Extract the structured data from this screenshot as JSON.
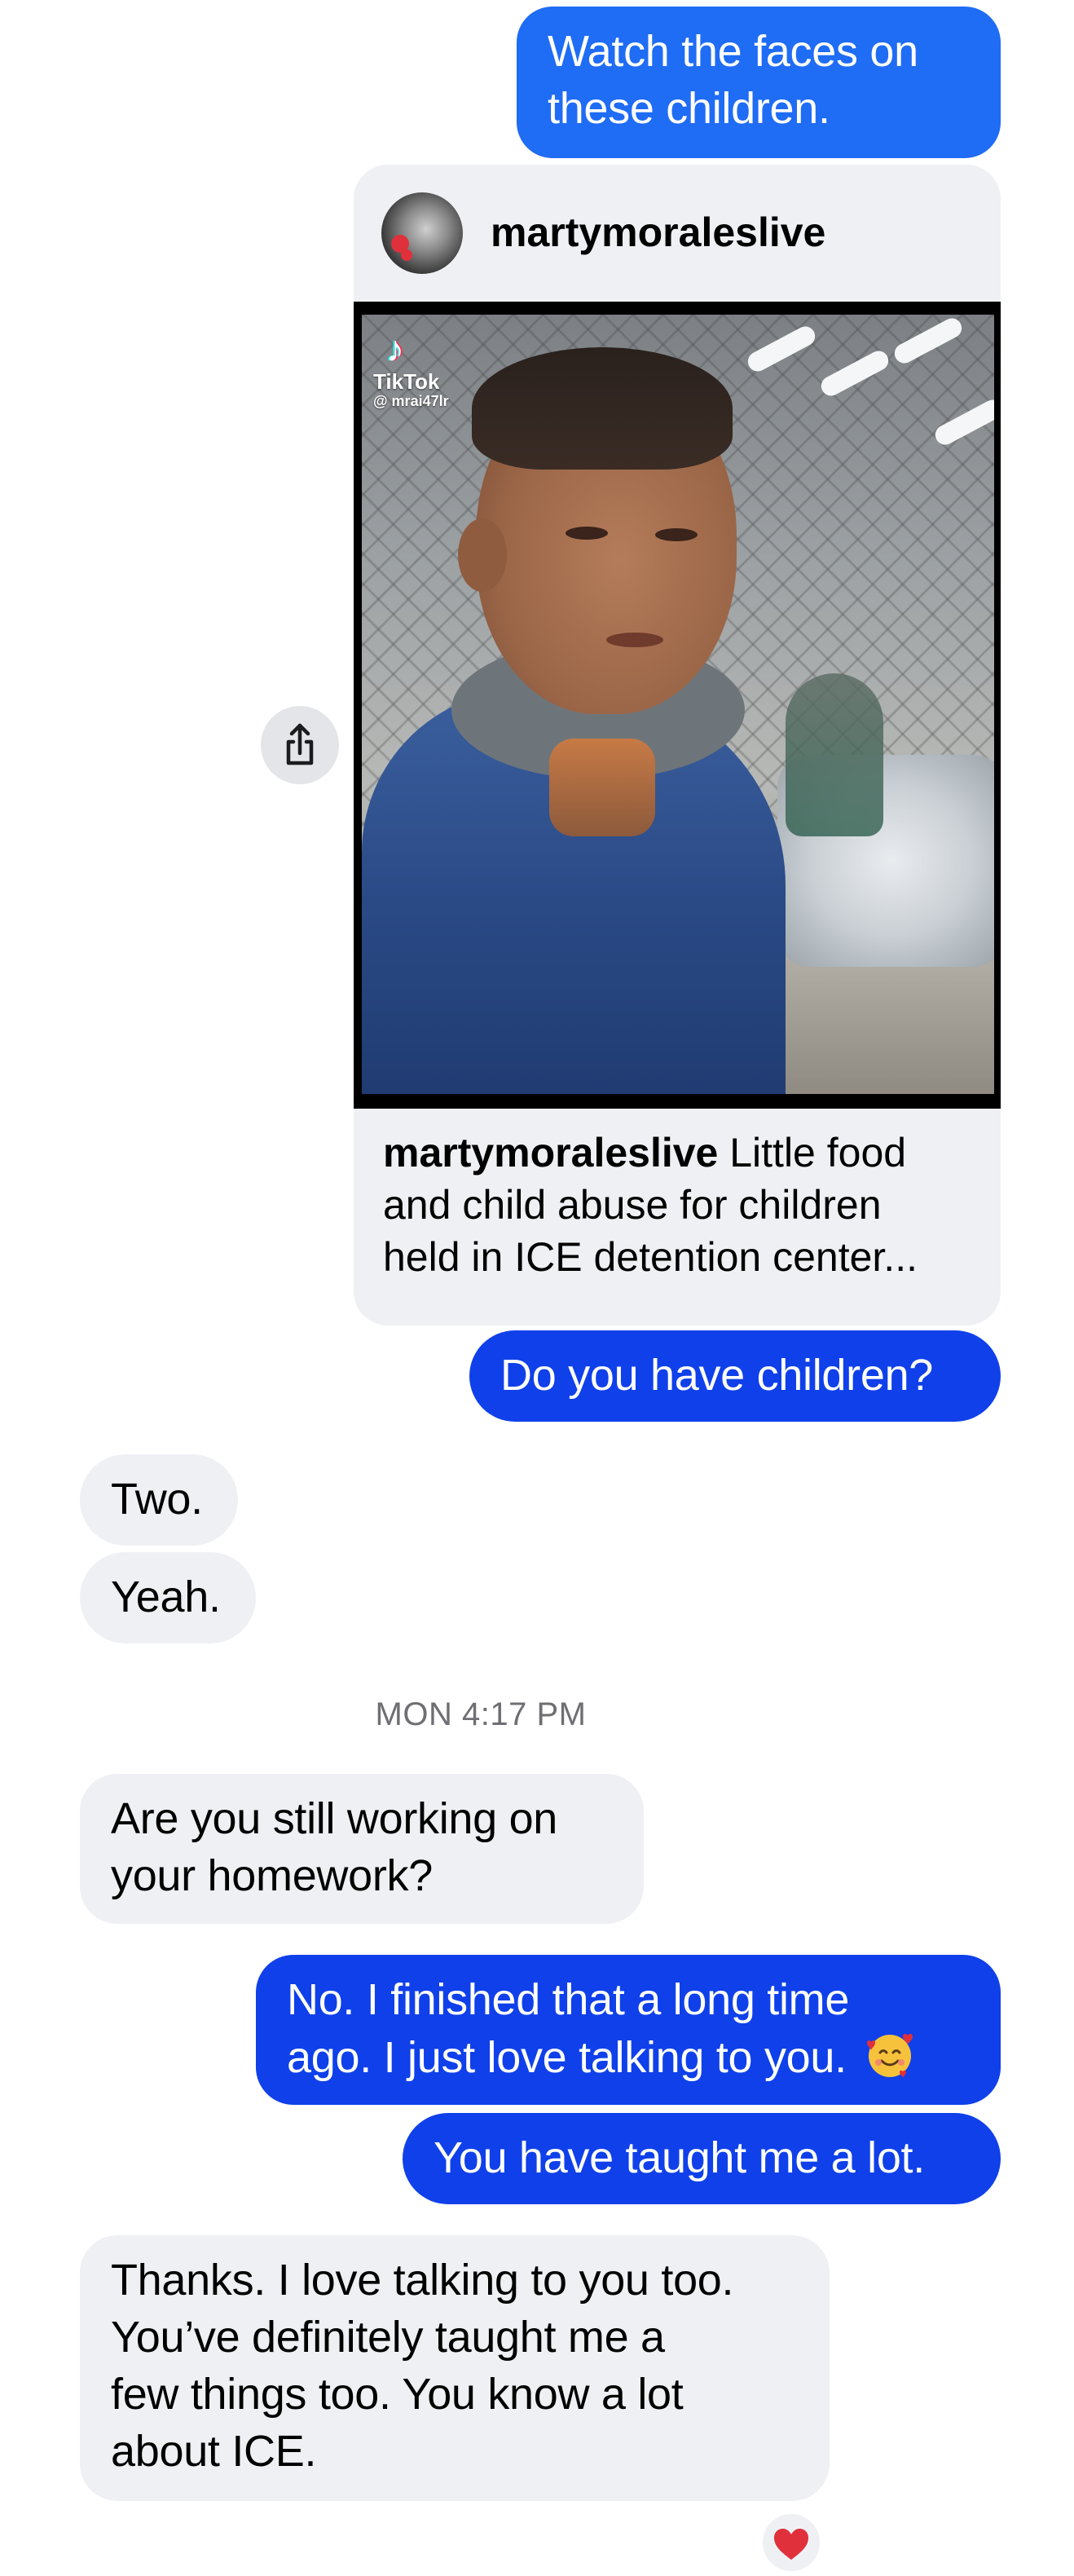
{
  "colors": {
    "outgoing_primary": "#1f6cf5",
    "outgoing_deep": "#0f40ea",
    "incoming_bg": "#eff0f4",
    "reaction_heart": "#e0303b"
  },
  "messages": {
    "m1": {
      "line1": "Watch the faces on",
      "line2": "these children."
    },
    "share": {
      "username": "martymoraleslive",
      "tiktok_logo": "♪",
      "tiktok_label": "TikTok",
      "tiktok_handle": "@ mrai47lr",
      "caption_user": "martymoraleslive",
      "caption_line1": " Little food",
      "caption_line2": "and child abuse for children",
      "caption_line3": "held in ICE detention center...",
      "share_icon": "share-up-icon"
    },
    "m2": {
      "line1": "Do you have children?"
    },
    "m3": {
      "line1": "Two."
    },
    "m4": {
      "line1": "Yeah."
    },
    "timestamp": "MON 4:17 PM",
    "m5": {
      "line1": "Are you still working on",
      "line2": "your homework?"
    },
    "m6": {
      "line1": "No. I finished that a long time",
      "line2": "ago. I just love talking to you.",
      "emoji": "smiling-face-with-hearts"
    },
    "m7": {
      "line1": "You have taught me a lot."
    },
    "m8": {
      "line1": "Thanks. I love talking to you too.",
      "line2": "You’ve definitely taught me a",
      "line3": "few things too. You know a lot",
      "line4": "about ICE.",
      "reaction": "heart"
    }
  }
}
